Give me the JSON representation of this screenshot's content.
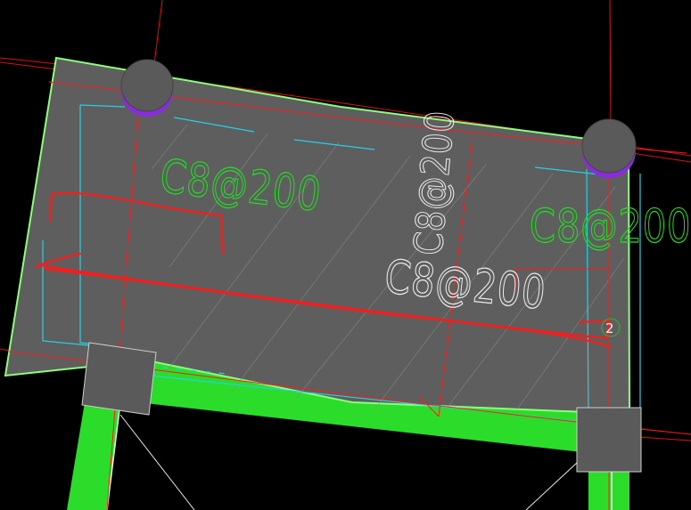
{
  "colors": {
    "background": "#000000",
    "slab_fill": "#5e5e5e",
    "slab_edge": "#8cff7a",
    "beam_green": "#2bdc2b",
    "cyan": "#22d3e6",
    "red": "#ff1a1a",
    "dark_red": "#b00000",
    "column_grey": "#5a5a5a",
    "column_purple": "#8a2be2",
    "label_green": "#22e022",
    "label_white": "#f0f0f0",
    "hatch": "#9a9a9a"
  },
  "labels": {
    "rebar_top_left": "C8@200",
    "rebar_vertical": "C8@200",
    "rebar_center": "C8@200",
    "rebar_right": "C8@200"
  },
  "markers": {
    "circle_number": "2"
  }
}
